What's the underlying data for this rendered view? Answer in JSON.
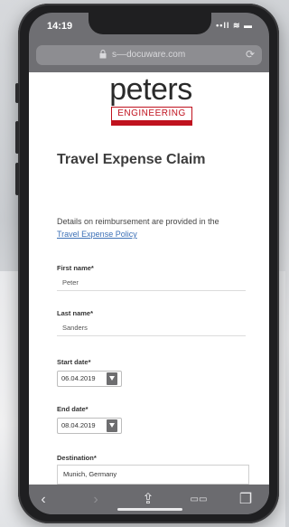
{
  "status_bar": {
    "time": "14:19",
    "icons": "••ll ≋ ▬"
  },
  "browser": {
    "url": "s––docuware.com",
    "reload_icon": "reload-icon"
  },
  "logo": {
    "word": "peters",
    "sub": "ENGINEERING",
    "brand_color": "#c0121e"
  },
  "page": {
    "title": "Travel Expense Claim",
    "intro_text": "Details on reimbursement are provided in the",
    "policy_link": "Travel Expense Policy"
  },
  "form": {
    "first_name": {
      "label": "First name*",
      "value": "Peter"
    },
    "last_name": {
      "label": "Last name*",
      "value": "Sanders"
    },
    "start_date": {
      "label": "Start date*",
      "value": "06.04.2019"
    },
    "end_date": {
      "label": "End date*",
      "value": "08.04.2019"
    },
    "destination": {
      "label": "Destination*",
      "value": "Munich, Germany"
    }
  },
  "toolbar": {
    "back": "‹",
    "forward": "›",
    "share": "⇪",
    "bookmarks": "▭▭",
    "tabs": "❐"
  }
}
